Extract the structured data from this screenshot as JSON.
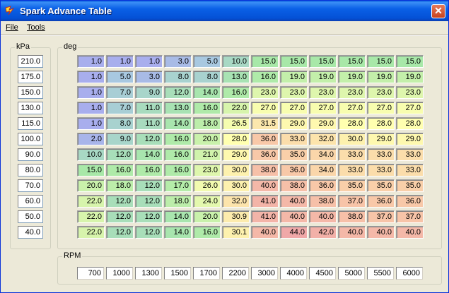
{
  "window": {
    "title": "Spark Advance Table",
    "close_label": "✕"
  },
  "menu": [
    {
      "label": "File"
    },
    {
      "label": "Tools"
    }
  ],
  "kpa_group": {
    "label": "kPa"
  },
  "deg_group": {
    "label": "deg"
  },
  "rpm_group": {
    "label": "RPM"
  },
  "kpa": [
    "210.0",
    "175.0",
    "150.0",
    "130.0",
    "115.0",
    "100.0",
    "90.0",
    "80.0",
    "70.0",
    "60.0",
    "50.0",
    "40.0"
  ],
  "rpm": [
    "700",
    "1000",
    "1300",
    "1500",
    "1700",
    "2200",
    "3000",
    "4000",
    "4500",
    "5000",
    "5500",
    "6000"
  ],
  "table": [
    [
      "1.0",
      "1.0",
      "1.0",
      "3.0",
      "5.0",
      "10.0",
      "15.0",
      "15.0",
      "15.0",
      "15.0",
      "15.0",
      "15.0"
    ],
    [
      "1.0",
      "5.0",
      "3.0",
      "8.0",
      "8.0",
      "13.0",
      "16.0",
      "19.0",
      "19.0",
      "19.0",
      "19.0",
      "19.0"
    ],
    [
      "1.0",
      "7.0",
      "9.0",
      "12.0",
      "14.0",
      "16.0",
      "23.0",
      "23.0",
      "23.0",
      "23.0",
      "23.0",
      "23.0"
    ],
    [
      "1.0",
      "7.0",
      "11.0",
      "13.0",
      "16.0",
      "22.0",
      "27.0",
      "27.0",
      "27.0",
      "27.0",
      "27.0",
      "27.0"
    ],
    [
      "1.0",
      "8.0",
      "11.0",
      "14.0",
      "18.0",
      "26.5",
      "31.5",
      "29.0",
      "29.0",
      "28.0",
      "28.0",
      "28.0"
    ],
    [
      "2.0",
      "9.0",
      "12.0",
      "16.0",
      "20.0",
      "28.0",
      "36.0",
      "33.0",
      "32.0",
      "30.0",
      "29.0",
      "29.0"
    ],
    [
      "10.0",
      "12.0",
      "14.0",
      "16.0",
      "21.0",
      "29.0",
      "36.0",
      "35.0",
      "34.0",
      "33.0",
      "33.0",
      "33.0"
    ],
    [
      "15.0",
      "16.0",
      "16.0",
      "16.0",
      "23.0",
      "30.0",
      "38.0",
      "36.0",
      "34.0",
      "33.0",
      "33.0",
      "33.0"
    ],
    [
      "20.0",
      "18.0",
      "12.0",
      "17.0",
      "26.0",
      "30.0",
      "40.0",
      "38.0",
      "36.0",
      "35.0",
      "35.0",
      "35.0"
    ],
    [
      "22.0",
      "12.0",
      "12.0",
      "18.0",
      "24.0",
      "32.0",
      "41.0",
      "40.0",
      "38.0",
      "37.0",
      "36.0",
      "36.0"
    ],
    [
      "22.0",
      "12.0",
      "12.0",
      "14.0",
      "20.0",
      "30.9",
      "41.0",
      "40.0",
      "40.0",
      "38.0",
      "37.0",
      "37.0"
    ],
    [
      "22.0",
      "12.0",
      "12.0",
      "14.0",
      "16.0",
      "30.1",
      "40.0",
      "44.0",
      "42.0",
      "40.0",
      "40.0",
      "40.0"
    ]
  ],
  "colors": {
    "low": "#a8a8f0",
    "mid": "#a8e8a8",
    "warm": "#ffffb0",
    "high": "#f0a8a8"
  }
}
